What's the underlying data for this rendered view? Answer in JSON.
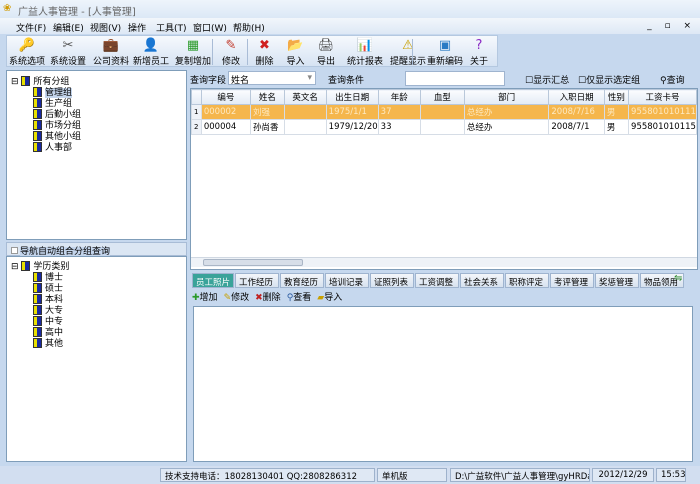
{
  "window": {
    "title": "广益人事管理 - [人事管理]",
    "controls": "_ ▫ ×"
  },
  "menu": [
    "文件(F)",
    "编辑(E)",
    "视图(V)",
    "操作",
    "工具(T)",
    "窗口(W)",
    "帮助(H)"
  ],
  "toolbar": [
    {
      "label": "系统选项",
      "icon": "key-icon",
      "glyph": "🔑"
    },
    {
      "label": "系统设置",
      "icon": "tools-icon",
      "glyph": "✂"
    },
    {
      "label": "公司资料",
      "icon": "briefcase-icon",
      "glyph": "💼"
    },
    {
      "label": "新增员工",
      "icon": "add-user-icon",
      "glyph": "👤"
    },
    {
      "label": "复制增加",
      "icon": "copy-add-icon",
      "glyph": "▦"
    },
    {
      "label": "修改",
      "icon": "pen-icon",
      "glyph": "✎"
    },
    {
      "label": "删除",
      "icon": "delete-icon",
      "glyph": "✖"
    },
    {
      "label": "导入",
      "icon": "import-icon",
      "glyph": "📂"
    },
    {
      "label": "导出",
      "icon": "export-icon",
      "glyph": "🖨"
    },
    {
      "label": "统计报表",
      "icon": "chart-icon",
      "glyph": "📊"
    },
    {
      "label": "提醒显示",
      "icon": "alert-icon",
      "glyph": "⚠"
    },
    {
      "label": "重新编码",
      "icon": "recode-icon",
      "glyph": "▣"
    },
    {
      "label": "关于",
      "icon": "help-icon",
      "glyph": "?"
    }
  ],
  "group_tree": {
    "root": "所有分组",
    "items": [
      "管理组",
      "生产组",
      "后勤小组",
      "市场分组",
      "其他小组",
      "人事部"
    ]
  },
  "nav": {
    "header": "导航自动组合分组查询",
    "root": "学历类别",
    "items": [
      "博士",
      "硕士",
      "本科",
      "大专",
      "中专",
      "高中",
      "其他"
    ]
  },
  "query": {
    "field_label": "查询字段",
    "field_value": "姓名",
    "cond_label": "查询条件",
    "cond_value": "",
    "show_summary": "显示汇总",
    "only_selected": "仅显示选定组",
    "search": "查询"
  },
  "grid": {
    "columns": [
      "编号",
      "姓名",
      "英文名",
      "出生日期",
      "年龄",
      "血型",
      "部门",
      "入职日期",
      "性别",
      "工资卡号"
    ],
    "rows": [
      [
        "1",
        "000002",
        "刘强",
        "",
        "1975/1/1",
        "37",
        "",
        "总经办",
        "2008/7/16",
        "男",
        "955801010111"
      ],
      [
        "2",
        "000004",
        "孙尚香",
        "",
        "1979/12/20",
        "33",
        "",
        "总经办",
        "2008/7/1",
        "男",
        "955801010115"
      ]
    ]
  },
  "tabs": [
    "员工照片",
    "工作经历",
    "教育经历",
    "培训记录",
    "证照列表",
    "工资调整",
    "社会关系",
    "职称评定",
    "考评管理",
    "奖惩管理",
    "物品领用"
  ],
  "subtoolbar": [
    "增加",
    "修改",
    "删除",
    "查看",
    "导入"
  ],
  "status": {
    "support": "技术支持电话：18028130401 QQ:2808286312",
    "edition": "单机版",
    "path": "D:\\广益软件\\广益人事管理\\gyHRData",
    "date": "2012/12/29",
    "time": "15:53"
  }
}
